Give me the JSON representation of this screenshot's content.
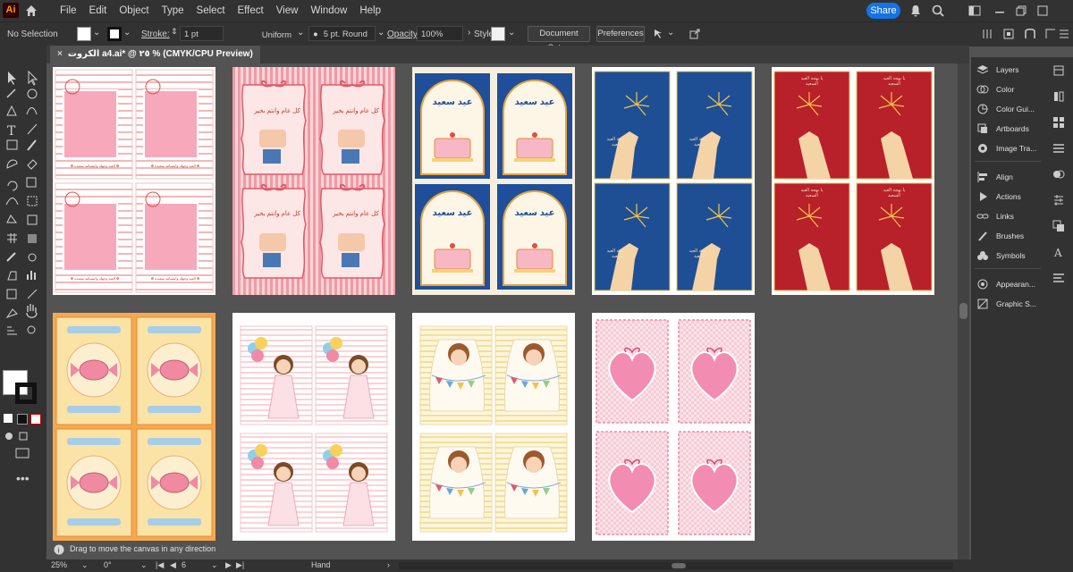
{
  "app": {
    "logo_text": "Ai"
  },
  "menu": [
    "File",
    "Edit",
    "Object",
    "Type",
    "Select",
    "Effect",
    "View",
    "Window",
    "Help"
  ],
  "share_label": "Share",
  "control_bar": {
    "selection": "No Selection",
    "stroke_label": "Stroke:",
    "stroke_value": "1 pt",
    "profile": "Uniform",
    "brush": "5 pt. Round",
    "opacity_label": "Opacity:",
    "opacity_value": "100%",
    "style_label": "Style:",
    "document_setup": "Document Setup",
    "preferences": "Preferences"
  },
  "document_tab": {
    "title": "الكروت a4.ai* @ ٢٥ % (CMYK/CPU Preview)",
    "close": "×"
  },
  "panels": [
    "Layers",
    "Color",
    "Color Gui...",
    "Artboards",
    "Image Tra...",
    "Align",
    "Actions",
    "Links",
    "Brushes",
    "Symbols",
    "Appearan...",
    "Graphic S..."
  ],
  "status": {
    "hint": "Drag to move the canvas in any direction",
    "zoom": "25%",
    "rotation": "0°",
    "artboard_number": "6",
    "tool": "Hand"
  },
  "colors": {
    "accent": "#1473e6",
    "chrome": "#323232",
    "canvas": "#535353"
  },
  "artboards": [
    {
      "theme": "pink-stamp",
      "card_text": "❁ العيد وجهك وابتسامة سعيدة ❁",
      "bg": "#fff7f5",
      "accent": "#e88a96"
    },
    {
      "theme": "bow-hand",
      "card_text": "كل عام وانتم بخير",
      "bg": "#f4b6bc",
      "accent": "#e05a6a"
    },
    {
      "theme": "cake-arch",
      "card_text": "عيد سعيد",
      "bg": "#f6efe0",
      "accent": "#1f4f9a"
    },
    {
      "theme": "sparkler-blue",
      "card_text": "يا بهجة العيد السعيد",
      "bg": "#1e4f95",
      "accent": "#e7c35c"
    },
    {
      "theme": "sparkler-red",
      "card_text": "يا بهجة العيد السعيد",
      "bg": "#b8202a",
      "accent": "#f0c45a"
    },
    {
      "theme": "candy",
      "card_text": "",
      "bg": "#f5b25a",
      "accent": "#e47f92"
    },
    {
      "theme": "girl-balloons",
      "card_text": "",
      "bg": "#fdeaea",
      "accent": "#f29bb0"
    },
    {
      "theme": "boy-bunting",
      "card_text": "",
      "bg": "#fbf3d9",
      "accent": "#c9823f"
    },
    {
      "theme": "heart",
      "card_text": "",
      "bg": "#fbd9e3",
      "accent": "#ef8fb0"
    }
  ]
}
